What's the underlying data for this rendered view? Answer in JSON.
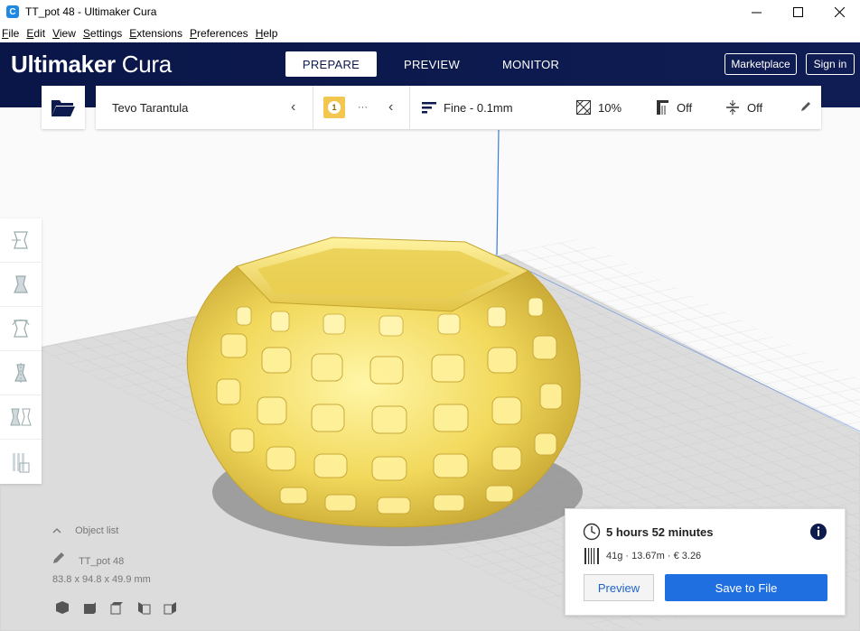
{
  "window": {
    "title": "TT_pot 48 - Ultimaker Cura",
    "app_icon_letter": "C"
  },
  "menu": [
    {
      "u": "F",
      "rest": "ile"
    },
    {
      "u": "E",
      "rest": "dit"
    },
    {
      "u": "V",
      "rest": "iew"
    },
    {
      "u": "S",
      "rest": "ettings"
    },
    {
      "u": "E",
      "rest": "xtensions"
    },
    {
      "u": "P",
      "rest": "references"
    },
    {
      "u": "H",
      "rest": "elp"
    }
  ],
  "header": {
    "logo_bold": "Ultimaker",
    "logo_light": "Cura",
    "tabs": [
      "PREPARE",
      "PREVIEW",
      "MONITOR"
    ],
    "active_tab": "PREPARE",
    "marketplace": "Marketplace",
    "signin": "Sign in"
  },
  "printer": {
    "name": "Tevo Tarantula",
    "extruder_badge": "1",
    "extruder_more": "···"
  },
  "print_settings": {
    "profile": "Fine - 0.1mm",
    "infill": "10%",
    "support": "Off",
    "adhesion": "Off"
  },
  "object_list": {
    "title": "Object list",
    "object_name": "TT_pot 48",
    "dimensions": "83.8 x 94.8 x 49.9 mm"
  },
  "estimate": {
    "time": "5 hours 52 minutes",
    "material": "41g · 13.67m · € 3.26",
    "preview_button": "Preview",
    "save_button": "Save to File"
  },
  "colors": {
    "header_bg": "#0d1a4f",
    "accent": "#1f6fe0",
    "model": "#f2d95c"
  }
}
